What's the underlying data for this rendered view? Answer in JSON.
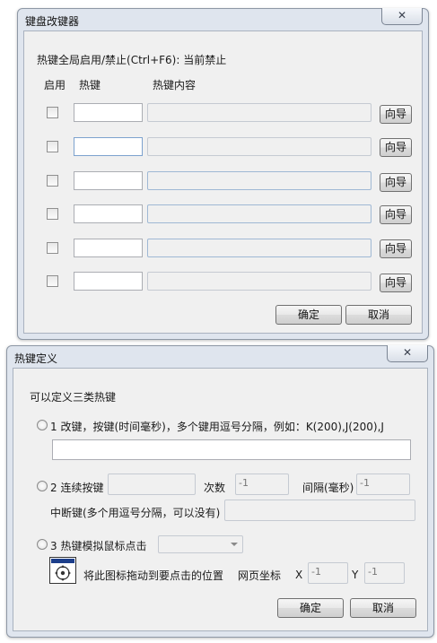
{
  "window1": {
    "title": "键盘改键器",
    "close_icon": "close-icon",
    "status_text": "热键全局启用/禁止(Ctrl+F6):  当前禁止",
    "col_enable": "启用",
    "col_hotkey": "热键",
    "col_content": "热键内容",
    "rows": [
      {
        "wizard_label": "向导"
      },
      {
        "wizard_label": "向导"
      },
      {
        "wizard_label": "向导"
      },
      {
        "wizard_label": "向导"
      },
      {
        "wizard_label": "向导"
      },
      {
        "wizard_label": "向导"
      }
    ],
    "ok_label": "确定",
    "cancel_label": "取消"
  },
  "window2": {
    "title": "热键定义",
    "close_icon": "close-icon",
    "heading": "可以定义三类热键",
    "option1_label": "1 改键，按键(时间毫秒)，多个键用逗号分隔，例如：K(200),J(200),J",
    "option2_label": "2 连续按键",
    "count_label": "次数",
    "count_value": "-1",
    "interval_label": "间隔(毫秒)",
    "interval_value": "-1",
    "break_key_label": "中断键(多个用逗号分隔，可以没有)",
    "option3_label": "3 热键模拟鼠标点击",
    "drag_hint": "将此图标拖动到要点击的位置",
    "page_coord_label": "网页坐标",
    "x_label": "X",
    "x_value": "-1",
    "y_label": "Y",
    "y_value": "-1",
    "mouse_icon": "crosshair-target-icon",
    "ok_label": "确定",
    "cancel_label": "取消"
  }
}
